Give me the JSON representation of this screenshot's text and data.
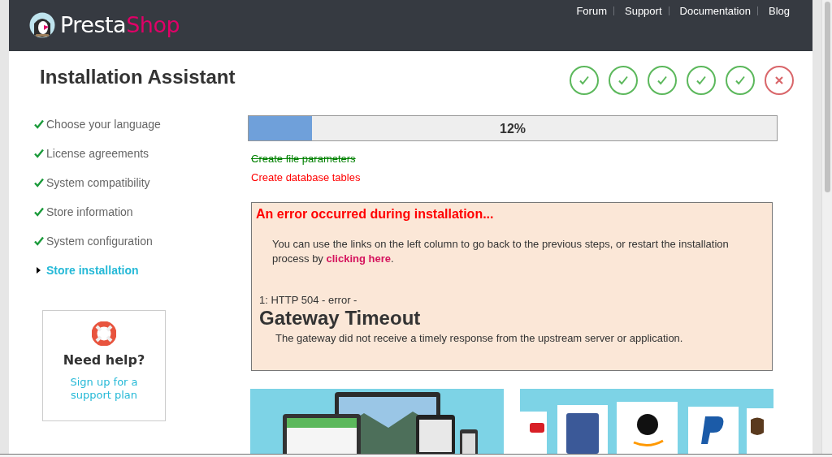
{
  "header": {
    "logo": {
      "first": "Presta",
      "second": "Shop"
    },
    "nav": [
      "Forum",
      "Support",
      "Documentation",
      "Blog"
    ]
  },
  "title": "Installation Assistant",
  "step_indicators": [
    {
      "done": true
    },
    {
      "done": true
    },
    {
      "done": true
    },
    {
      "done": true
    },
    {
      "done": true
    },
    {
      "done": false
    }
  ],
  "sidebar": {
    "steps": [
      {
        "label": "Choose your language",
        "selected": false
      },
      {
        "label": "License agreements",
        "selected": false
      },
      {
        "label": "System compatibility",
        "selected": false
      },
      {
        "label": "Store information",
        "selected": false
      },
      {
        "label": "System configuration",
        "selected": false
      },
      {
        "label": "Store installation",
        "selected": true
      }
    ],
    "help": {
      "title": "Need help?",
      "link": "Sign up for a support plan"
    }
  },
  "progress": {
    "level": 0.12,
    "reading": "12%"
  },
  "tasks": [
    {
      "label": "Create file parameters",
      "done": true
    },
    {
      "label": "Create database tables",
      "done": false
    }
  ],
  "error": {
    "title": "An error occurred during installation...",
    "message": "You can use the links on the left column to go back to the previous steps, or restart the installation process by",
    "link": "clicking here",
    "after_link": ".",
    "code": "1: HTTP 504 - error -",
    "heading": "Gateway Timeout",
    "detail": "The gateway did not receive a timely response from the upstream server or application."
  }
}
